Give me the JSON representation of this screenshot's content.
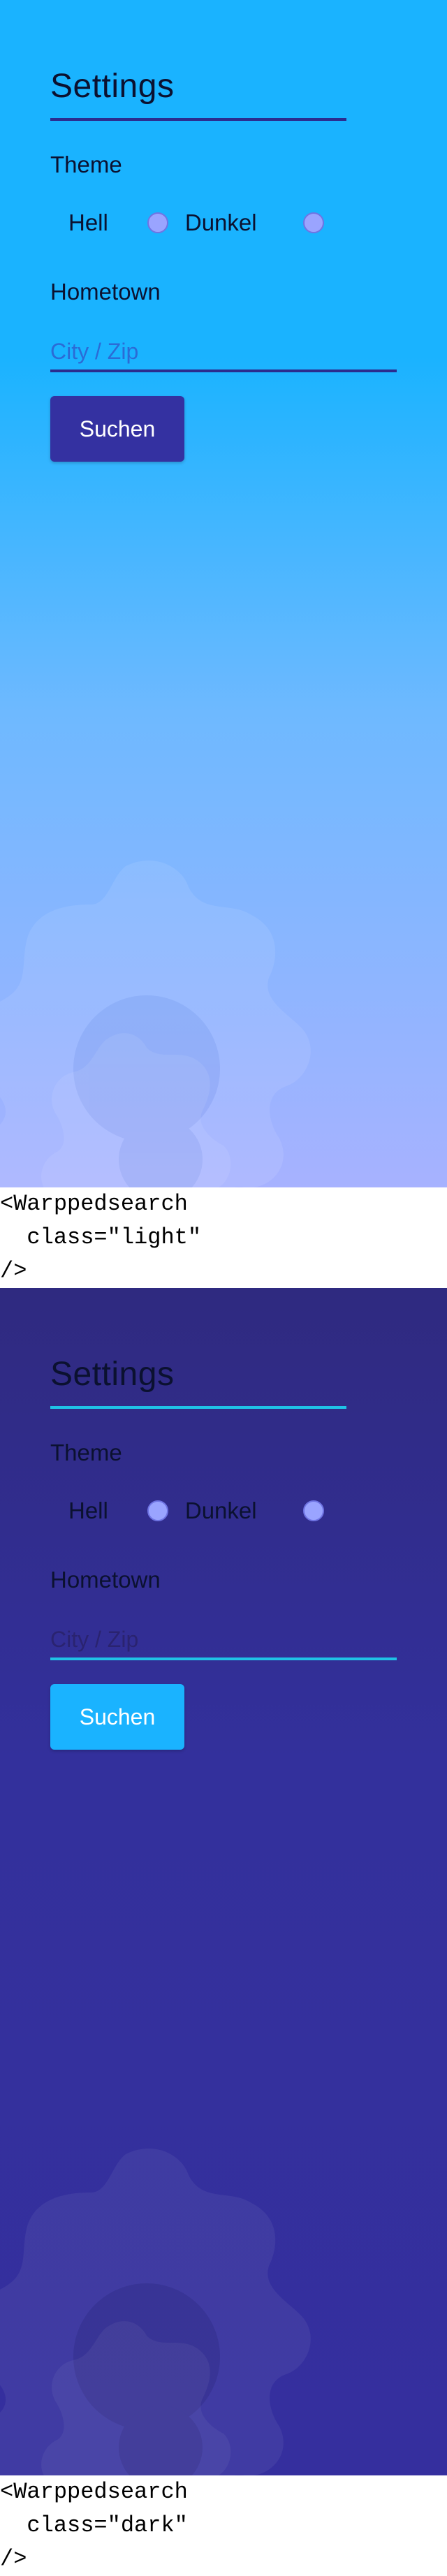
{
  "panels": [
    {
      "variant": "light",
      "title": "Settings",
      "theme_label": "Theme",
      "options": [
        {
          "label": "Hell"
        },
        {
          "label": "Dunkel"
        }
      ],
      "hometown_label": "Hometown",
      "input_placeholder": "City / Zip",
      "button_label": "Suchen"
    },
    {
      "variant": "dark",
      "title": "Settings",
      "theme_label": "Theme",
      "options": [
        {
          "label": "Hell"
        },
        {
          "label": "Dunkel"
        }
      ],
      "hometown_label": "Hometown",
      "input_placeholder": "City / Zip",
      "button_label": "Suchen"
    }
  ],
  "code_blocks": [
    "<Warppedsearch\n  class=\"light\"\n/>",
    "<Warppedsearch\n  class=\"dark\"\n/>"
  ],
  "colors": {
    "light_background": "#1ab3ff",
    "light_accent": "#2b2c8f",
    "dark_background": "#33309c",
    "dark_accent": "#1fc2e6",
    "radio_fill": "#9aa4ff"
  },
  "icons": {
    "background": "gear-icon"
  }
}
